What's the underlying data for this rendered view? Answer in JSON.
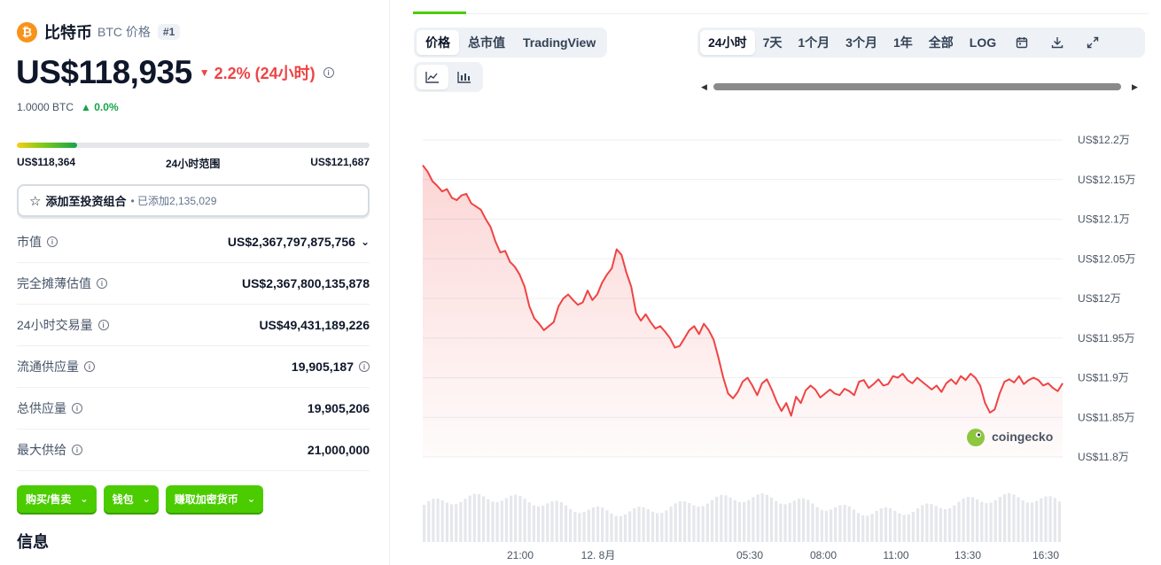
{
  "coin": {
    "logo_glyph": "₿",
    "name": "比特币",
    "symbol_label": "BTC 价格",
    "rank": "#1",
    "price": "US$118,935",
    "change_arrow": "▼",
    "change": "2.2% (24小时)",
    "btc_value": "1.0000 BTC",
    "btc_change": "▲ 0.0%"
  },
  "range": {
    "low": "US$118,364",
    "label": "24小时范围",
    "high": "US$121,687",
    "position_fraction": 0.17
  },
  "portfolio": {
    "label": "添加至投资组合",
    "added": "• 已添加2,135,029"
  },
  "stats": [
    {
      "label": "市值",
      "value": "US$2,367,797,875,756"
    },
    {
      "label": "完全摊薄估值",
      "value": "US$2,367,800,135,878"
    },
    {
      "label": "24小时交易量",
      "value": "US$49,431,189,226"
    },
    {
      "label": "流通供应量",
      "value": "19,905,187"
    },
    {
      "label": "总供应量",
      "value": "19,905,206"
    },
    {
      "label": "最大供给",
      "value": "21,000,000"
    }
  ],
  "actions": {
    "buy_sell": "购买/售卖",
    "wallet": "钱包",
    "earn": "赚取加密货币"
  },
  "info_title": "信息",
  "chart_controls": {
    "views": [
      "价格",
      "总市值",
      "TradingView"
    ],
    "ranges": [
      "24小时",
      "7天",
      "1个月",
      "3个月",
      "1年",
      "全部",
      "LOG"
    ]
  },
  "colors": {
    "accent_green": "#4bcc00",
    "down_red": "#ef4444",
    "up_green": "#16a34a"
  },
  "chart_data": {
    "type": "area",
    "watermark": "coingecko",
    "y_unit": "万 USD",
    "ylim": [
      11.8,
      12.2
    ],
    "y_ticks": [
      12.2,
      12.15,
      12.1,
      12.05,
      12.0,
      11.95,
      11.9,
      11.85,
      11.8
    ],
    "y_tick_labels": [
      "US$12.2万",
      "US$12.15万",
      "US$12.1万",
      "US$12.05万",
      "US$12万",
      "US$11.95万",
      "US$11.9万",
      "US$11.85万",
      "US$11.8万"
    ],
    "x_tick_labels": [
      "21:00",
      "12. 8月",
      "05:30",
      "08:00",
      "11:00",
      "13:30",
      "16:30"
    ],
    "values": [
      12.168,
      12.16,
      12.148,
      12.142,
      12.135,
      12.138,
      12.127,
      12.124,
      12.13,
      12.132,
      12.12,
      12.116,
      12.112,
      12.1,
      12.09,
      12.072,
      12.058,
      12.06,
      12.046,
      12.04,
      12.03,
      12.015,
      11.99,
      11.975,
      11.968,
      11.96,
      11.965,
      11.97,
      11.99,
      12.0,
      12.005,
      11.998,
      11.992,
      11.995,
      12.01,
      11.998,
      12.005,
      12.02,
      12.03,
      12.038,
      12.062,
      12.055,
      12.033,
      12.015,
      11.982,
      11.972,
      11.98,
      11.97,
      11.962,
      11.965,
      11.958,
      11.95,
      11.938,
      11.94,
      11.95,
      11.96,
      11.965,
      11.955,
      11.968,
      11.96,
      11.948,
      11.925,
      11.9,
      11.88,
      11.874,
      11.882,
      11.895,
      11.9,
      11.89,
      11.878,
      11.893,
      11.898,
      11.885,
      11.87,
      11.858,
      11.868,
      11.852,
      11.876,
      11.868,
      11.884,
      11.89,
      11.885,
      11.875,
      11.88,
      11.885,
      11.88,
      11.878,
      11.886,
      11.883,
      11.878,
      11.895,
      11.897,
      11.887,
      11.892,
      11.898,
      11.89,
      11.892,
      11.902,
      11.9,
      11.905,
      11.897,
      11.893,
      11.9,
      11.895,
      11.89,
      11.885,
      11.89,
      11.882,
      11.893,
      11.898,
      11.892,
      11.902,
      11.897,
      11.905,
      11.9,
      11.89,
      11.868,
      11.856,
      11.86,
      11.88,
      11.895,
      11.898,
      11.894,
      11.902,
      11.892,
      11.897,
      11.9,
      11.897,
      11.89,
      11.893,
      11.887,
      11.883,
      11.893
    ]
  }
}
